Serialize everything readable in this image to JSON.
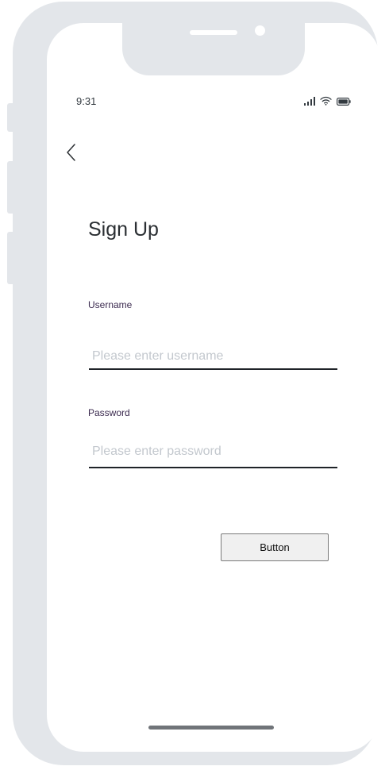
{
  "status_bar": {
    "time": "9:31",
    "icons": [
      "signal-icon",
      "wifi-icon",
      "battery-icon"
    ]
  },
  "header": {
    "back_icon": "chevron-left-icon"
  },
  "form": {
    "title": "Sign Up",
    "username": {
      "label": "Username",
      "placeholder": "Please enter username",
      "value": ""
    },
    "password": {
      "label": "Password",
      "placeholder": "Please enter password",
      "value": ""
    },
    "button_label": "Button"
  },
  "colors": {
    "frame": "#e3e6ea",
    "label_text": "#3b2a4f",
    "placeholder": "#c3c8ce",
    "underline": "#1f2328",
    "button_bg": "#f0f0f0",
    "button_border": "#7a7a7a"
  }
}
